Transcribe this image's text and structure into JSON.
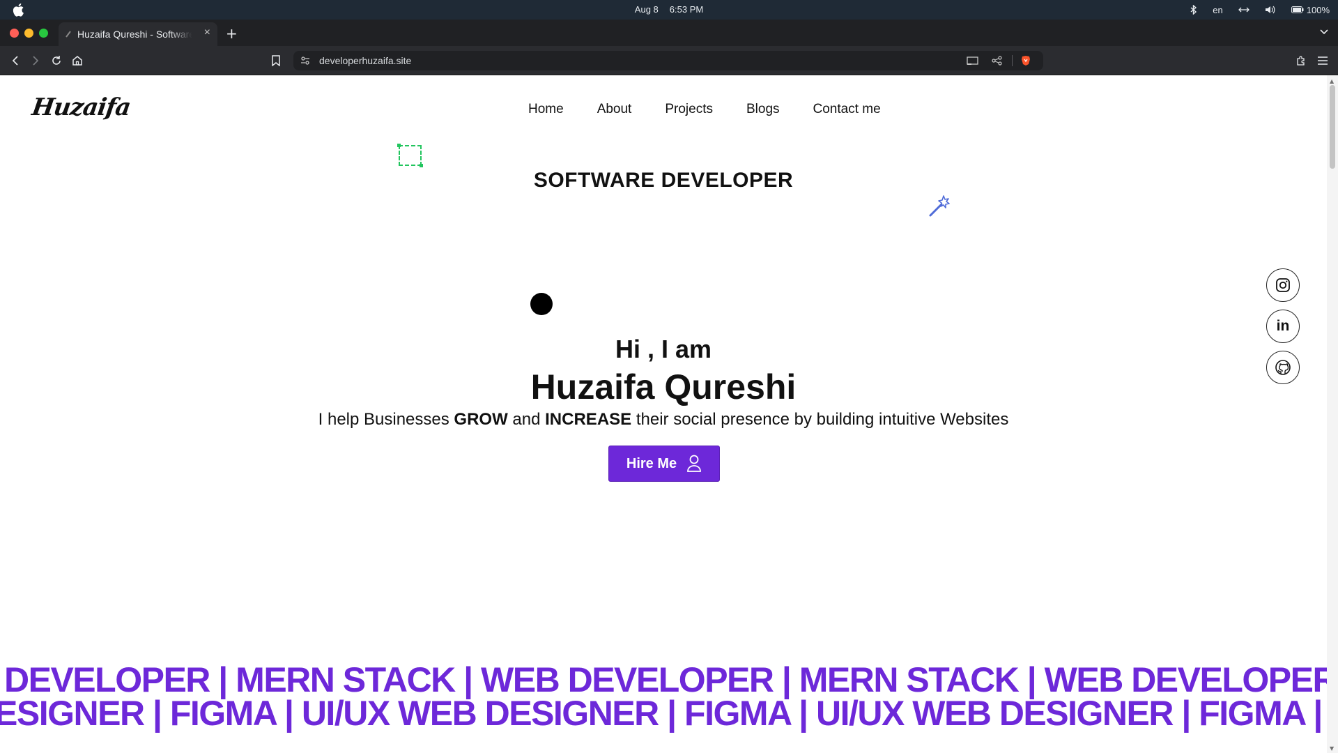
{
  "menubar": {
    "date": "Aug 8",
    "time": "6:53 PM",
    "language": "en",
    "battery": "100%",
    "icons": [
      "apple-icon",
      "bluetooth-icon",
      "network-icon",
      "volume-icon",
      "battery-icon"
    ]
  },
  "browser": {
    "tab_title": "Huzaifa Qureshi - Software Developer",
    "tab_close": "×",
    "new_tab": "+",
    "url": "developerhuzaifa.site"
  },
  "site": {
    "logo": "Huzaifa",
    "nav": [
      "Home",
      "About",
      "Projects",
      "Blogs",
      "Contact me"
    ],
    "role": "SOFTWARE DEVELOPER",
    "greeting": "Hi , I am",
    "name": "Huzaifa Qureshi",
    "tagline": {
      "part1": "I help Businesses ",
      "bold1": "GROW",
      "part2": " and ",
      "bold2": "INCREASE",
      "part3": " their social presence by building intuitive Websites"
    },
    "hire_button": "Hire Me",
    "social": [
      "instagram-icon",
      "linkedin-icon",
      "github-icon"
    ],
    "linkedin_text": "in",
    "marquee_line1": "DEVELOPER |   MERN STACK | WEB DEVELOPER |   MERN STACK | WEB DEVELOPER |",
    "marquee_line2": "ESIGNER | FIGMA |   UI/UX WEB DESIGNER | FIGMA |   UI/UX WEB DESIGNER | FIGMA |"
  },
  "colors": {
    "accent": "#6d28d9",
    "menubar": "#1f2a36",
    "browser_chrome": "#2b2c30",
    "deco_green": "#22c55e",
    "wand_blue": "#4f6bd8"
  }
}
